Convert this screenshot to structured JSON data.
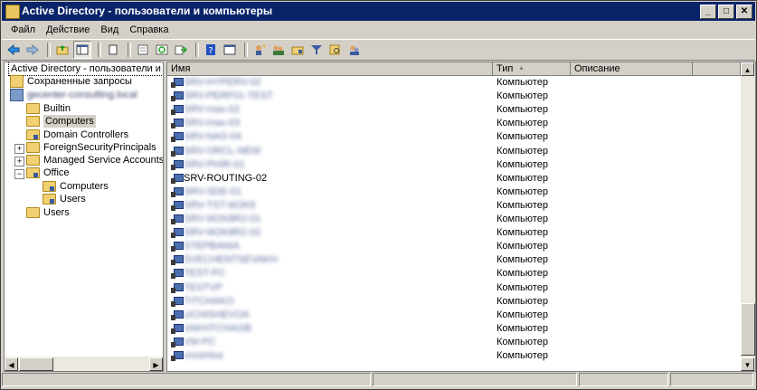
{
  "window": {
    "title": "Active Directory - пользователи и компьютеры",
    "buttons": [
      "_",
      "□",
      "✕"
    ]
  },
  "menu": [
    "Файл",
    "Действие",
    "Вид",
    "Справка"
  ],
  "toolbar_icons": [
    "back-icon",
    "forward-icon",
    "up-folder-icon",
    "show-tree-icon",
    "copy-icon",
    "properties-icon",
    "refresh-icon",
    "export-icon",
    "help-icon",
    "view-icon",
    "add-user-icon",
    "add-group-icon",
    "add-ou-icon",
    "filter-icon",
    "find-icon",
    "move-icon"
  ],
  "tree": {
    "root": "Active Directory - пользователи и ко",
    "saved_queries": "Сохраненные запросы",
    "domain": "gecenter-consulting.local",
    "items": [
      {
        "label": "Builtin"
      },
      {
        "label": "Computers"
      },
      {
        "label": "Domain Controllers"
      },
      {
        "label": "ForeignSecurityPrincipals"
      },
      {
        "label": "Managed Service Accounts"
      },
      {
        "label": "Office"
      },
      {
        "label": "Computers"
      },
      {
        "label": "Users"
      },
      {
        "label": "Users"
      }
    ]
  },
  "list": {
    "columns": [
      "Имя",
      "Тип",
      "Описание"
    ],
    "sort_indicator": "▲",
    "rows": [
      {
        "name": "SRV-HYPERV-02",
        "type": "Компьютер"
      },
      {
        "name": "SRV-PERF01-TEST",
        "type": "Компьютер"
      },
      {
        "name": "SRV-max-02",
        "type": "Компьютер"
      },
      {
        "name": "SRV-max-03",
        "type": "Компьютер"
      },
      {
        "name": "SRV-NAS-04",
        "type": "Компьютер"
      },
      {
        "name": "SRV-ORCL-NEW",
        "type": "Компьютер"
      },
      {
        "name": "SRV-PHIR-01",
        "type": "Компьютер"
      },
      {
        "name": "SRV-ROUTING-02",
        "type": "Компьютер"
      },
      {
        "name": "SRV-SDE-01",
        "type": "Компьютер"
      },
      {
        "name": "SRV-TST-W2K8",
        "type": "Компьютер"
      },
      {
        "name": "SRV-W2K8R2-01",
        "type": "Компьютер"
      },
      {
        "name": "SRV-W2K8R2-02",
        "type": "Компьютер"
      },
      {
        "name": "STEPBANIA",
        "type": "Компьютер"
      },
      {
        "name": "SVECHENTSEVAKH",
        "type": "Компьютер"
      },
      {
        "name": "TEST-PC",
        "type": "Компьютер"
      },
      {
        "name": "TESTVP",
        "type": "Компьютер"
      },
      {
        "name": "TITCHAKO",
        "type": "Компьютер"
      },
      {
        "name": "UCHISHEVOA",
        "type": "Компьютер"
      },
      {
        "name": "VAKHTCHAGB",
        "type": "Компьютер"
      },
      {
        "name": "VM-PC",
        "type": "Компьютер"
      },
      {
        "name": "vncentus",
        "type": "Компьютер"
      }
    ]
  }
}
